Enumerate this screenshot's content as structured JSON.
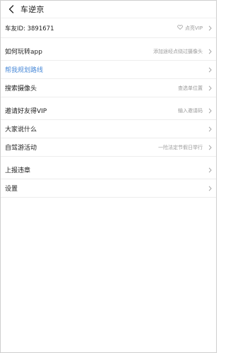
{
  "header": {
    "title": "车逆京"
  },
  "profile": {
    "id_label": "车友ID: 3891671",
    "vip_text": "点亮VIP"
  },
  "group1": [
    {
      "label": "如何玩转app",
      "value": "添加途经点绕过摄像头",
      "highlight": false
    },
    {
      "label": "帮我规划路线",
      "value": "",
      "highlight": true
    },
    {
      "label": "搜索摄像头",
      "value": "查选单位置",
      "highlight": false
    }
  ],
  "group2": [
    {
      "label": "邀请好友得VIP",
      "value": "输入邀请码"
    },
    {
      "label": "大家说什么",
      "value": ""
    },
    {
      "label": "自驾游活动",
      "value": "一险法定节假日举行"
    }
  ],
  "group3": [
    {
      "label": "上报违章",
      "value": ""
    },
    {
      "label": "设置",
      "value": ""
    }
  ],
  "colors": {
    "accent": "#4a8ad8",
    "muted": "#9a9a9a"
  }
}
